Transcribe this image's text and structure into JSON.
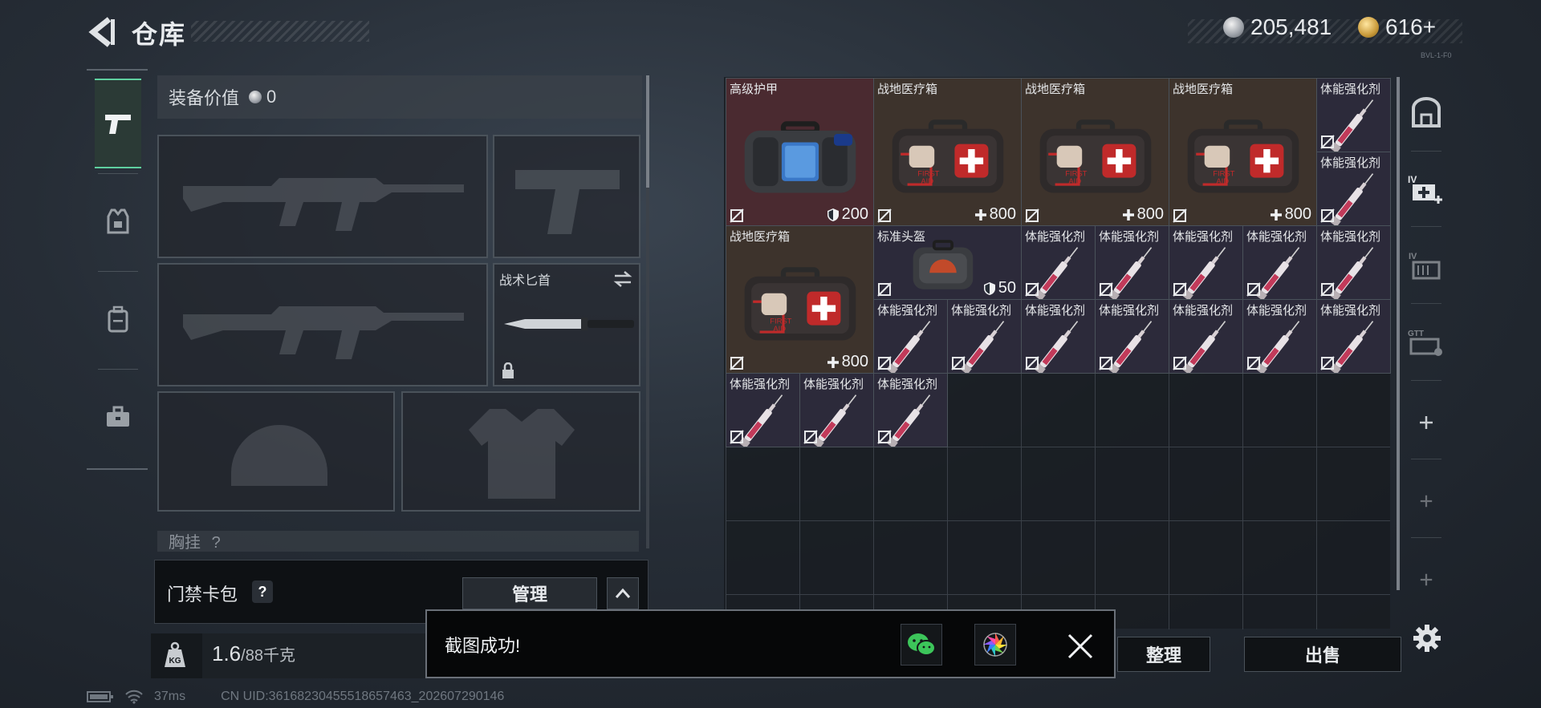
{
  "header": {
    "title": "仓库",
    "currency_silver": "205,481",
    "currency_gold": "616+",
    "version_tag": "BVL-1-F0"
  },
  "left_tabs": [
    {
      "name": "weapons",
      "icon": "pistol-icon",
      "active": true
    },
    {
      "name": "vest",
      "icon": "vest-icon",
      "active": false
    },
    {
      "name": "backpack",
      "icon": "backpack-icon",
      "active": false
    },
    {
      "name": "toolbox",
      "icon": "briefcase-icon",
      "active": false
    }
  ],
  "equipment": {
    "value_label": "装备价值",
    "value": "0",
    "knife_label": "战术匕首",
    "chest_label": "胸挂",
    "chest_badge": "?"
  },
  "keycard": {
    "label": "门禁卡包",
    "help": "?",
    "manage_label": "管理"
  },
  "weight": {
    "current": "1.6",
    "max": "/88千克",
    "icon": "weight-kg-icon"
  },
  "inventory": {
    "items": [
      {
        "name": "高级护甲",
        "value": "200",
        "value_icon": "shield-icon",
        "rarity": "red",
        "icon": "armor-bag-icon"
      },
      {
        "name": "战地医疗箱",
        "value": "800",
        "value_icon": "plus-icon",
        "rarity": "gold",
        "icon": "first-aid-kit-icon"
      },
      {
        "name": "战地医疗箱",
        "value": "800",
        "value_icon": "plus-icon",
        "rarity": "gold",
        "icon": "first-aid-kit-icon"
      },
      {
        "name": "战地医疗箱",
        "value": "800",
        "value_icon": "plus-icon",
        "rarity": "gold",
        "icon": "first-aid-kit-icon"
      },
      {
        "name": "体能强化剂",
        "rarity": "purple",
        "icon": "syringe-icon"
      },
      {
        "name": "体能强化剂",
        "rarity": "purple",
        "icon": "syringe-icon"
      },
      {
        "name": "战地医疗箱",
        "value": "800",
        "value_icon": "plus-icon",
        "rarity": "gold",
        "icon": "first-aid-kit-icon"
      },
      {
        "name": "标准头盔",
        "value": "50",
        "value_icon": "shield-icon",
        "rarity": "purple",
        "icon": "helmet-bag-icon"
      },
      {
        "name": "体能强化剂",
        "rarity": "purple",
        "icon": "syringe-icon"
      },
      {
        "name": "体能强化剂",
        "rarity": "purple",
        "icon": "syringe-icon"
      },
      {
        "name": "体能强化剂",
        "rarity": "purple",
        "icon": "syringe-icon"
      },
      {
        "name": "体能强化剂",
        "rarity": "purple",
        "icon": "syringe-icon"
      },
      {
        "name": "体能强化剂",
        "rarity": "purple",
        "icon": "syringe-icon"
      },
      {
        "name": "体能强化剂",
        "rarity": "purple",
        "icon": "syringe-icon"
      },
      {
        "name": "体能强化剂",
        "rarity": "purple",
        "icon": "syringe-icon"
      },
      {
        "name": "体能强化剂",
        "rarity": "purple",
        "icon": "syringe-icon"
      },
      {
        "name": "体能强化剂",
        "rarity": "purple",
        "icon": "syringe-icon"
      },
      {
        "name": "体能强化剂",
        "rarity": "purple",
        "icon": "syringe-icon"
      },
      {
        "name": "体能强化剂",
        "rarity": "purple",
        "icon": "syringe-icon"
      },
      {
        "name": "体能强化剂",
        "rarity": "purple",
        "icon": "syringe-icon"
      },
      {
        "name": "体能强化剂",
        "rarity": "purple",
        "icon": "syringe-icon"
      },
      {
        "name": "体能强化剂",
        "rarity": "purple",
        "icon": "syringe-icon"
      },
      {
        "name": "体能强化剂",
        "rarity": "purple",
        "icon": "syringe-icon"
      }
    ]
  },
  "side_buttons": [
    "safe-box-icon",
    "medkit-add-icon",
    "ammo-box-icon",
    "gun-case-icon",
    "plus-icon",
    "plus-icon",
    "plus-icon"
  ],
  "actions": {
    "sort_label": "整理",
    "sell_label": "出售"
  },
  "toast": {
    "message": "截图成功!",
    "share_wechat_icon": "wechat-icon",
    "share_album_icon": "album-icon",
    "close_icon": "close-icon"
  },
  "status_bar": {
    "ping": "37ms",
    "uid": "CN UID:36168230455518657463_202607290146"
  },
  "colors": {
    "rarity_red": "#4a2a30",
    "rarity_gold": "#3d332c",
    "rarity_purple": "#2c2a3a",
    "accent_green": "#5fd0a0"
  }
}
